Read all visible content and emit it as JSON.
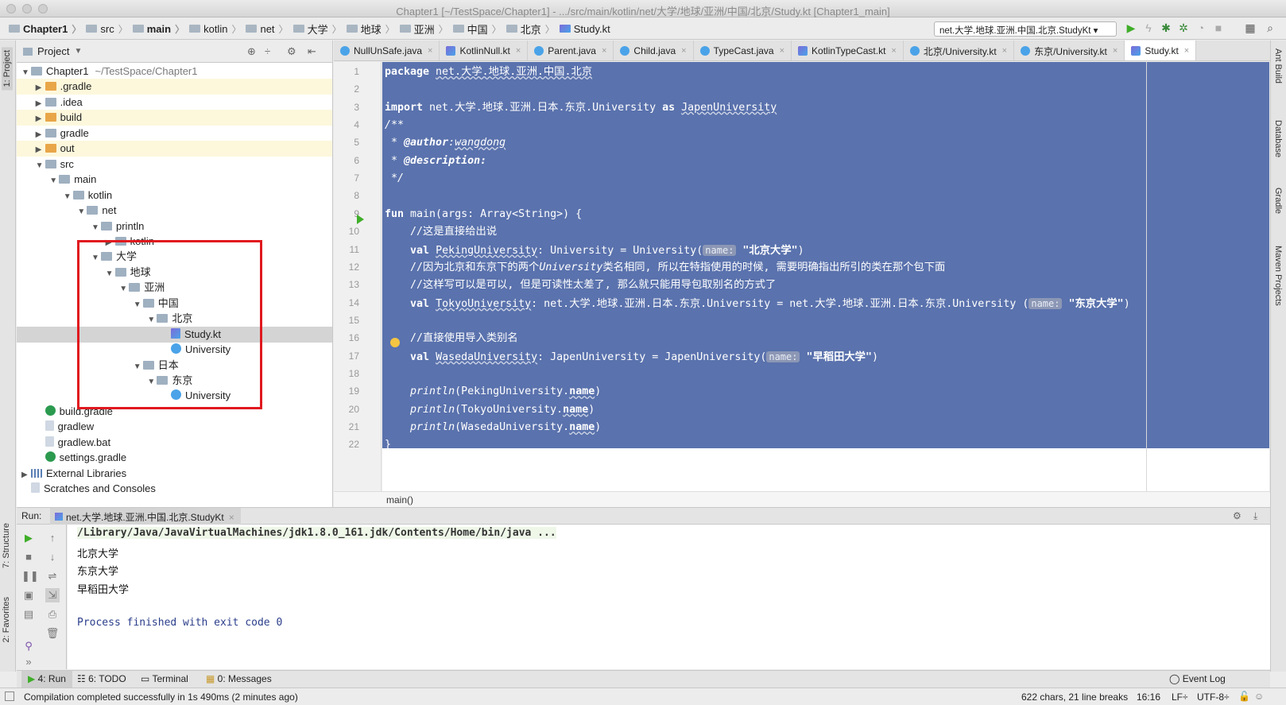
{
  "window": {
    "title": "Chapter1 [~/TestSpace/Chapter1] - .../src/main/kotlin/net/大学/地球/亚洲/中国/北京/Study.kt [Chapter1_main]"
  },
  "breadcrumbs": [
    "Chapter1",
    "src",
    "main",
    "kotlin",
    "net",
    "大学",
    "地球",
    "亚洲",
    "中国",
    "北京",
    "Study.kt"
  ],
  "toolbar": {
    "run_config": "net.大学.地球.亚洲.中国.北京.StudyKt"
  },
  "side_tabs": {
    "left": [
      "1: Project",
      "7: Structure",
      "2: Favorites"
    ],
    "right": [
      "Ant Build",
      "Database",
      "Gradle",
      "Maven Projects"
    ]
  },
  "project": {
    "header": "Project",
    "tree": [
      {
        "label": "Chapter1",
        "extra": "~/TestSpace/Chapter1",
        "depth": 0,
        "icon": "folder",
        "arrow": "▼",
        "hl": false
      },
      {
        "label": ".gradle",
        "depth": 1,
        "icon": "folder-o",
        "arrow": "▶",
        "hl": true
      },
      {
        "label": ".idea",
        "depth": 1,
        "icon": "folder",
        "arrow": "▶",
        "hl": false
      },
      {
        "label": "build",
        "depth": 1,
        "icon": "folder-o",
        "arrow": "▶",
        "hl": true
      },
      {
        "label": "gradle",
        "depth": 1,
        "icon": "folder",
        "arrow": "▶",
        "hl": false
      },
      {
        "label": "out",
        "depth": 1,
        "icon": "folder-o",
        "arrow": "▶",
        "hl": true
      },
      {
        "label": "src",
        "depth": 1,
        "icon": "folder",
        "arrow": "▼",
        "hl": false
      },
      {
        "label": "main",
        "depth": 2,
        "icon": "folder",
        "arrow": "▼",
        "hl": false
      },
      {
        "label": "kotlin",
        "depth": 3,
        "icon": "folder",
        "arrow": "▼",
        "hl": false
      },
      {
        "label": "net",
        "depth": 4,
        "icon": "folder",
        "arrow": "▼",
        "hl": false
      },
      {
        "label": "println",
        "depth": 5,
        "icon": "folder",
        "arrow": "▼",
        "hl": false
      },
      {
        "label": "kotlin",
        "depth": 6,
        "icon": "folder",
        "arrow": "▶",
        "hl": false
      },
      {
        "label": "大学",
        "depth": 5,
        "icon": "folder",
        "arrow": "▼",
        "hl": false
      },
      {
        "label": "地球",
        "depth": 6,
        "icon": "folder",
        "arrow": "▼",
        "hl": false
      },
      {
        "label": "亚洲",
        "depth": 7,
        "icon": "folder",
        "arrow": "▼",
        "hl": false
      },
      {
        "label": "中国",
        "depth": 8,
        "icon": "folder",
        "arrow": "▼",
        "hl": false
      },
      {
        "label": "北京",
        "depth": 9,
        "icon": "folder",
        "arrow": "▼",
        "hl": false
      },
      {
        "label": "Study.kt",
        "depth": 10,
        "icon": "kt",
        "arrow": "",
        "hl": false,
        "sel": true
      },
      {
        "label": "University",
        "depth": 10,
        "icon": "cls",
        "arrow": "",
        "hl": false
      },
      {
        "label": "日本",
        "depth": 8,
        "icon": "folder",
        "arrow": "▼",
        "hl": false
      },
      {
        "label": "东京",
        "depth": 9,
        "icon": "folder",
        "arrow": "▼",
        "hl": false
      },
      {
        "label": "University",
        "depth": 10,
        "icon": "cls",
        "arrow": "",
        "hl": false
      },
      {
        "label": "build.gradle",
        "depth": 1,
        "icon": "gradle",
        "arrow": "",
        "hl": false
      },
      {
        "label": "gradlew",
        "depth": 1,
        "icon": "file",
        "arrow": "",
        "hl": false
      },
      {
        "label": "gradlew.bat",
        "depth": 1,
        "icon": "file",
        "arrow": "",
        "hl": false
      },
      {
        "label": "settings.gradle",
        "depth": 1,
        "icon": "gradle",
        "arrow": "",
        "hl": false
      },
      {
        "label": "External Libraries",
        "depth": 0,
        "icon": "lib",
        "arrow": "▶",
        "hl": false
      },
      {
        "label": "Scratches and Consoles",
        "depth": 0,
        "icon": "file",
        "arrow": "",
        "hl": false
      }
    ]
  },
  "editor_tabs": [
    {
      "label": "NullUnSafe.java",
      "icon": "c",
      "active": false
    },
    {
      "label": "KotlinNull.kt",
      "icon": "k",
      "active": false
    },
    {
      "label": "Parent.java",
      "icon": "c",
      "active": false
    },
    {
      "label": "Child.java",
      "icon": "c",
      "active": false
    },
    {
      "label": "TypeCast.java",
      "icon": "c",
      "active": false
    },
    {
      "label": "KotlinTypeCast.kt",
      "icon": "k",
      "active": false
    },
    {
      "label": "北京/University.kt",
      "icon": "c",
      "active": false
    },
    {
      "label": "东京/University.kt",
      "icon": "c",
      "active": false
    },
    {
      "label": "Study.kt",
      "icon": "k",
      "active": true
    }
  ],
  "code_lines": [
    [
      {
        "t": "package ",
        "c": "kw"
      },
      {
        "t": "net.大学.地球.亚洲.中国.北京",
        "c": "ul"
      }
    ],
    [],
    [
      {
        "t": "import ",
        "c": "kw"
      },
      {
        "t": "net.大学.地球.亚洲.日本.东京.University "
      },
      {
        "t": "as ",
        "c": "kw"
      },
      {
        "t": "JapenUniversity",
        "c": "ul"
      }
    ],
    [
      {
        "t": "/**",
        "c": "it"
      }
    ],
    [
      {
        "t": " * ",
        "c": "it"
      },
      {
        "t": "@author",
        "c": "kw it"
      },
      {
        "t": ":",
        "c": "it"
      },
      {
        "t": "wangdong",
        "c": "it ul"
      }
    ],
    [
      {
        "t": " * ",
        "c": "it"
      },
      {
        "t": "@description:",
        "c": "kw it"
      }
    ],
    [
      {
        "t": " */",
        "c": "it"
      }
    ],
    [],
    [
      {
        "t": "fun ",
        "c": "kw"
      },
      {
        "t": "main(args: Array<String>) {"
      }
    ],
    [
      {
        "t": "    //这是直接给出说"
      }
    ],
    [
      {
        "t": "    "
      },
      {
        "t": "val ",
        "c": "kw"
      },
      {
        "t": "PekingUniversity",
        "c": "ul"
      },
      {
        "t": ": University = University("
      },
      {
        "t": "name:",
        "c": "hint"
      },
      {
        "t": " \"北京大学\"",
        "c": "kw"
      },
      {
        "t": ")"
      }
    ],
    [
      {
        "t": "    //因为北京和东京下的两个"
      },
      {
        "t": "University",
        "c": "it"
      },
      {
        "t": "类名相同, 所以在特指使用的时候, 需要明确指出所引的类在那个包下面"
      }
    ],
    [
      {
        "t": "    //这样写可以是可以, 但是可读性太差了, 那么就只能用导包取别名的方式了"
      }
    ],
    [
      {
        "t": "    "
      },
      {
        "t": "val ",
        "c": "kw"
      },
      {
        "t": "TokyoUniversity",
        "c": "ul"
      },
      {
        "t": ": net.大学.地球.亚洲.日本.东京.University = net.大学.地球.亚洲.日本.东京.University ("
      },
      {
        "t": "name:",
        "c": "hint"
      },
      {
        "t": " \"东京大学\"",
        "c": "kw"
      },
      {
        "t": ")"
      }
    ],
    [],
    [
      {
        "t": "    //直接使用导入类别名"
      }
    ],
    [
      {
        "t": "    "
      },
      {
        "t": "val ",
        "c": "kw"
      },
      {
        "t": "WasedaUniversity",
        "c": "ul"
      },
      {
        "t": ": JapenUniversity = JapenUniversity("
      },
      {
        "t": "name:",
        "c": "hint"
      },
      {
        "t": " \"早稻田大学\"",
        "c": "kw"
      },
      {
        "t": ")"
      }
    ],
    [],
    [
      {
        "t": "    "
      },
      {
        "t": "println",
        "c": "it"
      },
      {
        "t": "(PekingUniversity."
      },
      {
        "t": "name",
        "c": "kw ul"
      },
      {
        "t": ")"
      }
    ],
    [
      {
        "t": "    "
      },
      {
        "t": "println",
        "c": "it"
      },
      {
        "t": "(TokyoUniversity."
      },
      {
        "t": "name",
        "c": "kw ul"
      },
      {
        "t": ")"
      }
    ],
    [
      {
        "t": "    "
      },
      {
        "t": "println",
        "c": "it"
      },
      {
        "t": "(WasedaUniversity."
      },
      {
        "t": "name",
        "c": "kw ul"
      },
      {
        "t": ")"
      }
    ],
    [
      {
        "t": "}"
      }
    ]
  ],
  "editor_breadcrumb": "main()",
  "run": {
    "label": "Run:",
    "tab": "net.大学.地球.亚洲.中国.北京.StudyKt",
    "console": [
      "/Library/Java/JavaVirtualMachines/jdk1.8.0_161.jdk/Contents/Home/bin/java ...",
      "北京大学",
      "东京大学",
      "早稻田大学",
      "",
      "Process finished with exit code 0"
    ]
  },
  "bottom_tabs": {
    "run": "4: Run",
    "todo": "6: TODO",
    "terminal": "Terminal",
    "messages": "0: Messages",
    "event_log": "Event Log"
  },
  "status": {
    "message": "Compilation completed successfully in 1s 490ms (2 minutes ago)",
    "chars": "622 chars, 21 line breaks",
    "position": "16:16",
    "line_sep": "LF÷",
    "encoding": "UTF-8÷"
  },
  "colors": {
    "selection": "#5a72ad",
    "run_green": "#3fae29",
    "red_box": "#e0191f"
  }
}
